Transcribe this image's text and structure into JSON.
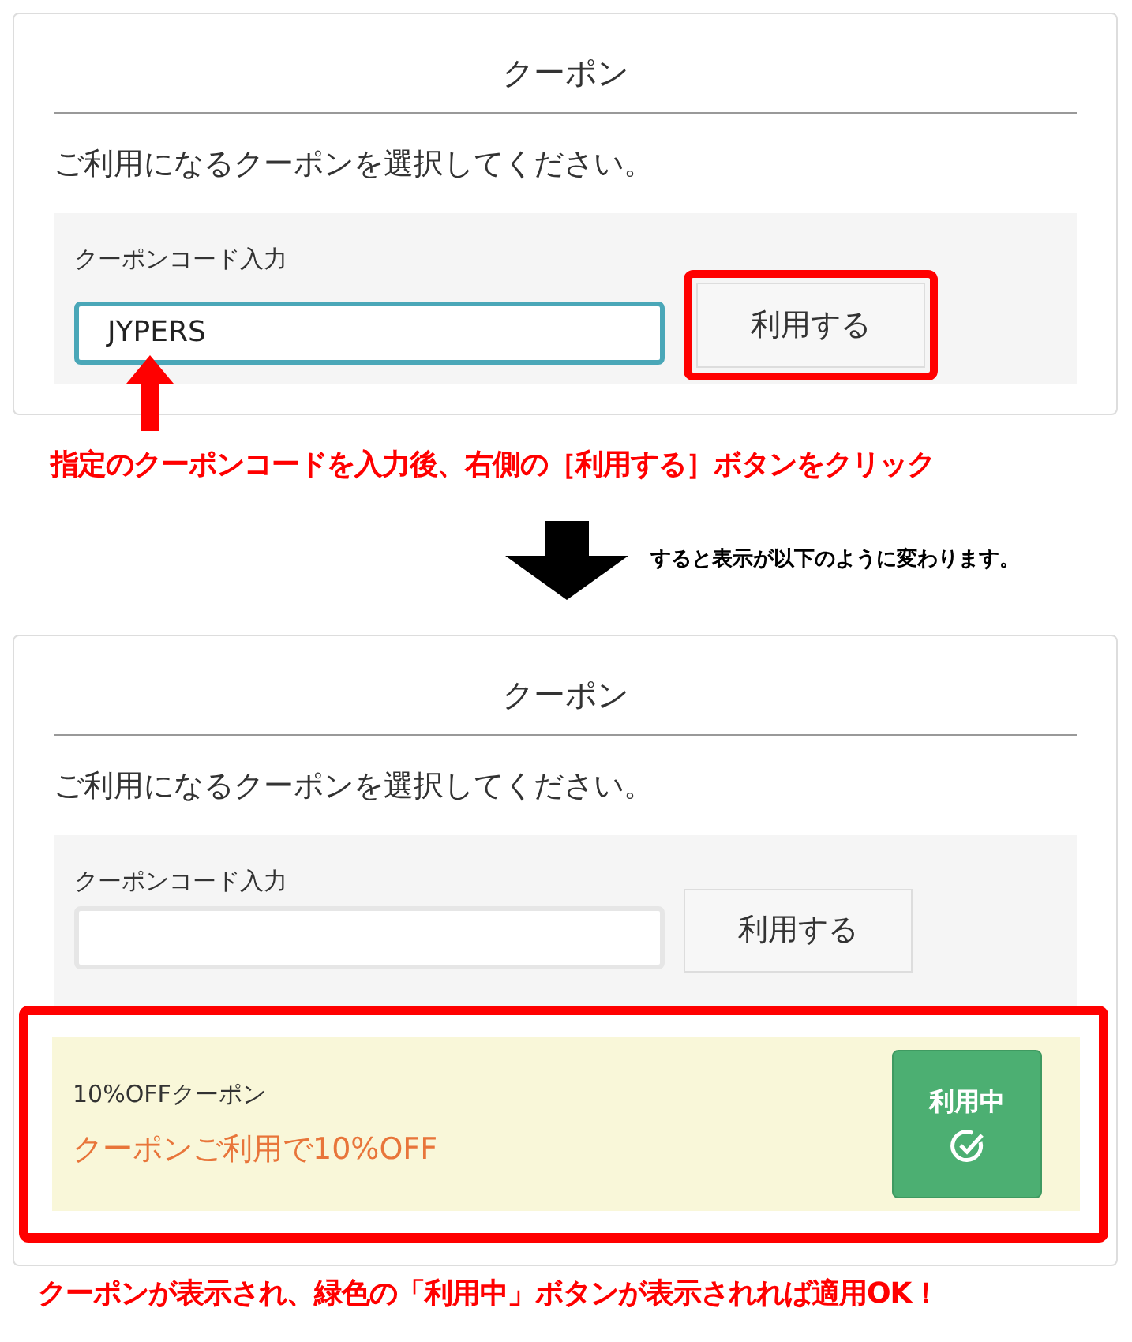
{
  "before": {
    "title": "クーポン",
    "prompt": "ご利用になるクーポンを選択してください。",
    "code_label": "クーポンコード入力",
    "code_value": "JYPERS",
    "apply_button": "利用する"
  },
  "note_1": "指定のクーポンコードを入力後、右側の［利用する］ボタンをクリック",
  "transition_note": "すると表示が以下のように変わります。",
  "after": {
    "title": "クーポン",
    "prompt": "ご利用になるクーポンを選択してください。",
    "code_label": "クーポンコード入力",
    "apply_button": "利用する",
    "coupon": {
      "name": "10%OFFクーポン",
      "description": "クーポンご利用で10%OFF",
      "status_button": "利用中",
      "applied": true
    }
  },
  "note_2": "クーポンが表示され、緑色の「利用中」ボタンが表示されれば適用OK！"
}
